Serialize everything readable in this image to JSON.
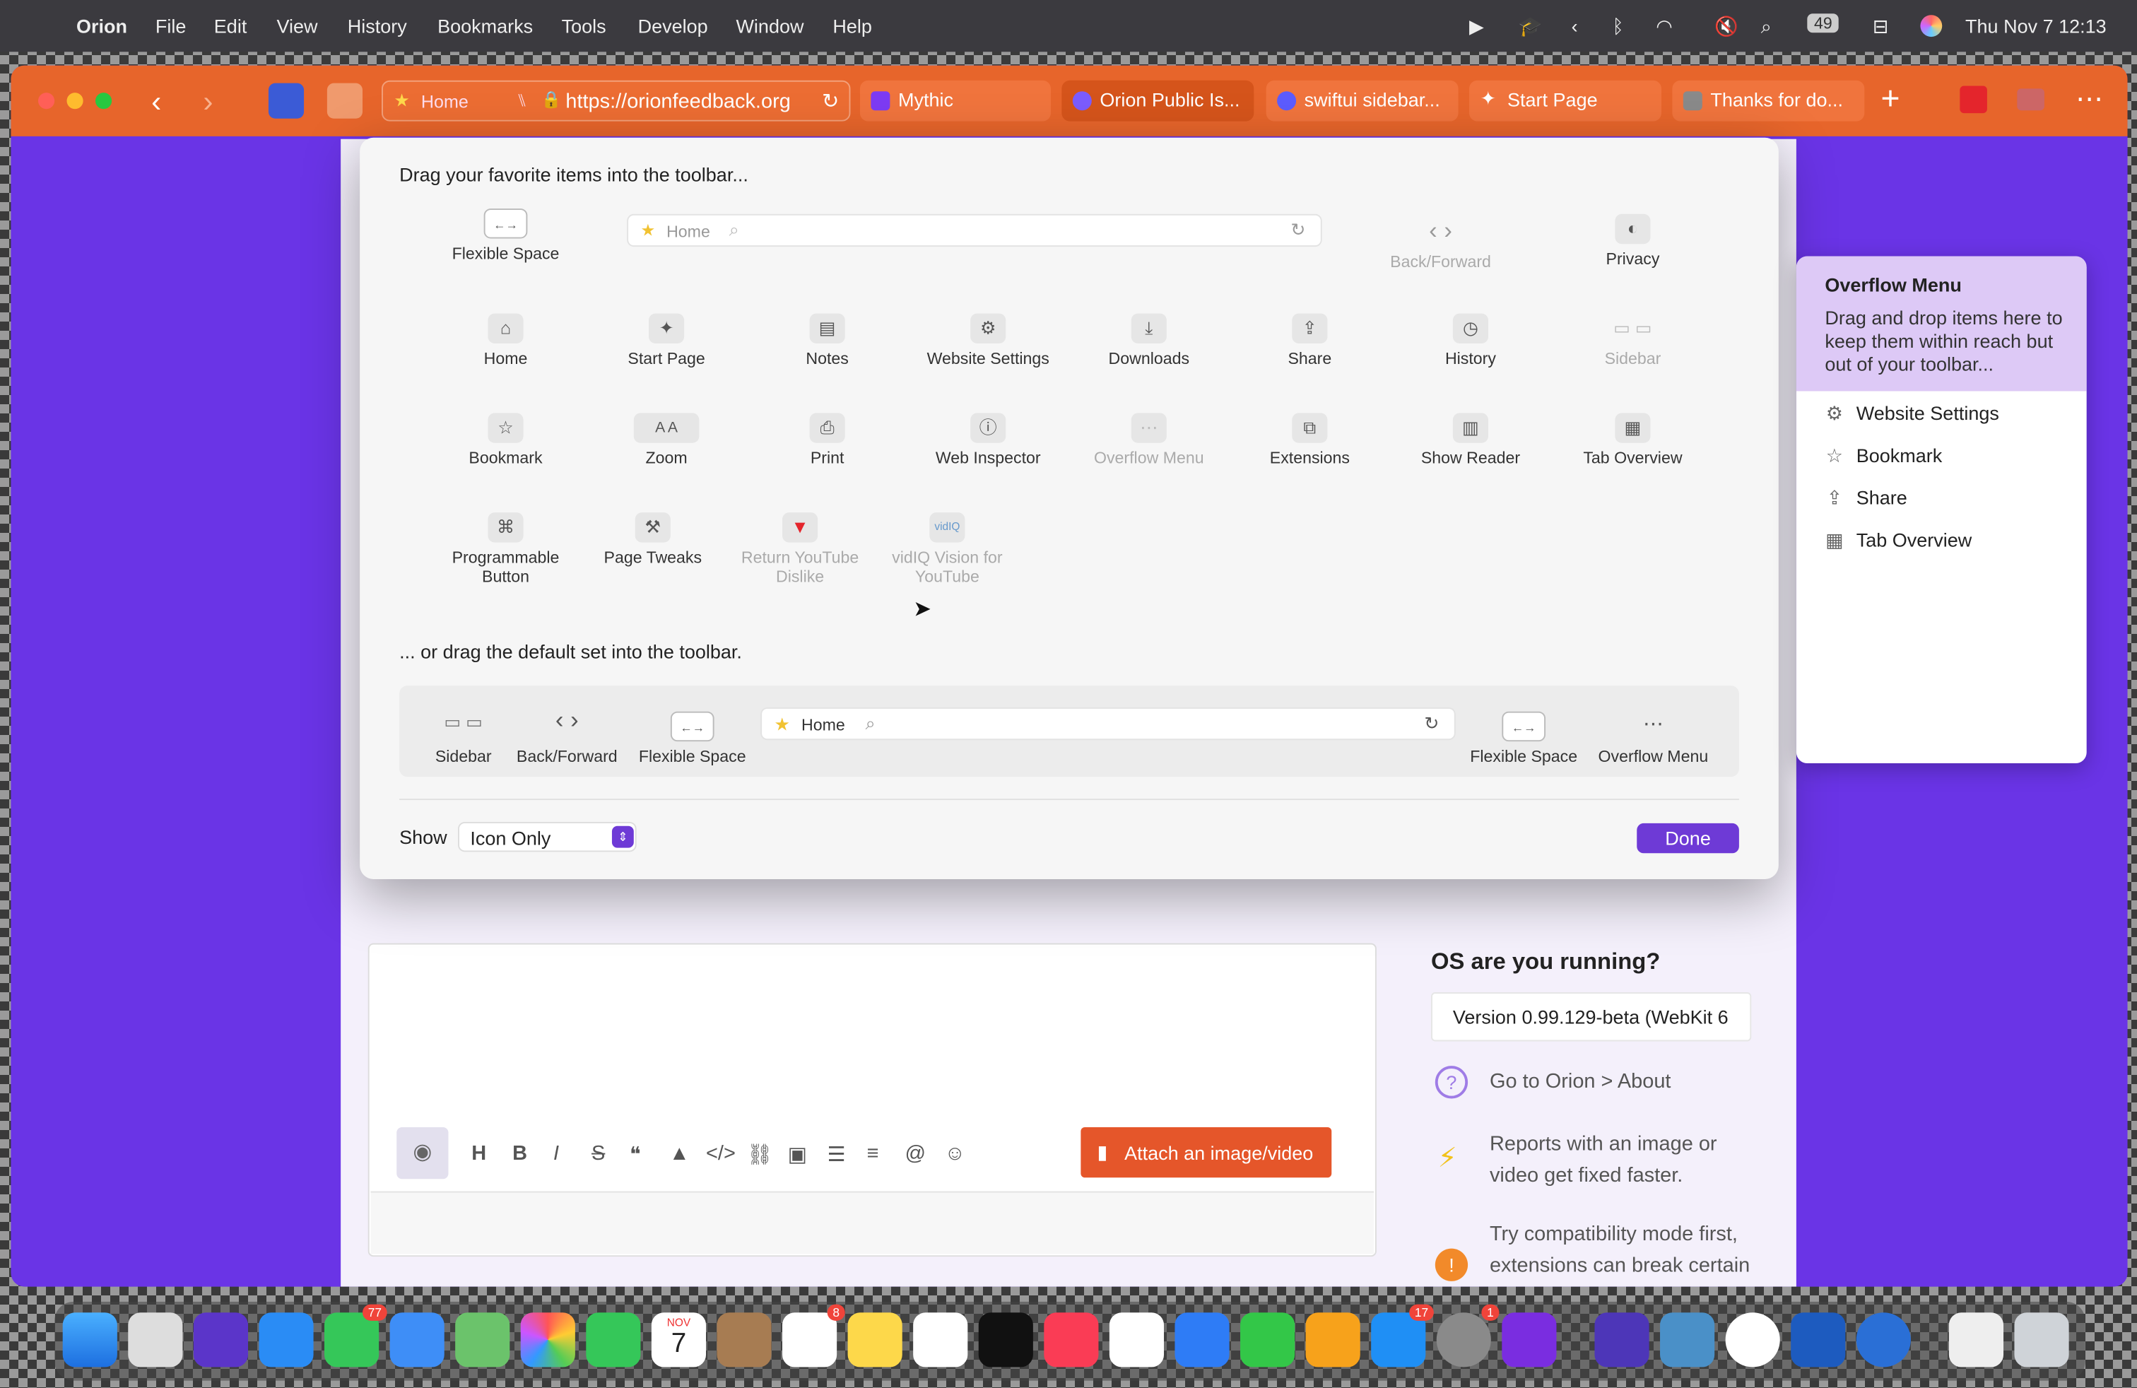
{
  "menubar": {
    "app": "Orion",
    "items": [
      "File",
      "Edit",
      "View",
      "History",
      "Bookmarks",
      "Tools",
      "Develop",
      "Window",
      "Help"
    ],
    "battery": "49",
    "datetime": "Thu Nov 7  12:13"
  },
  "toolbar": {
    "home_label": "Home",
    "url": "https://orionfeedback.org",
    "tabs": [
      {
        "label": "Mythic"
      },
      {
        "label": "Orion Public Is..."
      },
      {
        "label": "swiftui sidebar..."
      },
      {
        "label": "Start Page"
      },
      {
        "label": "Thanks for do..."
      }
    ]
  },
  "sheet": {
    "heading": "Drag your favorite items into the toolbar...",
    "row1": {
      "flexible_space": "Flexible Space",
      "home_chip": "Home",
      "back_forward": "Back/Forward",
      "privacy": "Privacy"
    },
    "row2": [
      "Home",
      "Start Page",
      "Notes",
      "Website Settings",
      "Downloads",
      "Share",
      "History",
      "Sidebar"
    ],
    "row3": [
      "Bookmark",
      "Zoom",
      "Print",
      "Web Inspector",
      "Overflow Menu",
      "Extensions",
      "Show Reader",
      "Tab Overview"
    ],
    "row4": [
      "Programmable Button",
      "Page Tweaks",
      "Return YouTube Dislike",
      "vidIQ Vision for YouTube"
    ],
    "default_heading": "... or drag the default set into the toolbar.",
    "default_set": {
      "sidebar": "Sidebar",
      "back_forward": "Back/Forward",
      "flex1": "Flexible Space",
      "home_chip": "Home",
      "flex2": "Flexible Space",
      "overflow": "Overflow Menu"
    },
    "show_label": "Show",
    "show_value": "Icon Only",
    "done": "Done"
  },
  "overflow_panel": {
    "title": "Overflow Menu",
    "desc": "Drag and drop items here to keep them within reach but out of your toolbar...",
    "items": [
      "Website Settings",
      "Bookmark",
      "Share",
      "Tab Overview"
    ]
  },
  "page": {
    "question": "OS are you running?",
    "version": "Version 0.99.129-beta (WebKit 6",
    "tip1": "Go to Orion > About",
    "tip2": "Reports with an image or video get fixed faster.",
    "tip3": "Try compatibility mode first, extensions can break certain websites.",
    "attach": "Attach an image/video"
  },
  "dock": {
    "badges": {
      "messages": "77",
      "reminders": "8",
      "appstore": "17",
      "settings": "1"
    },
    "calendar_month": "NOV",
    "calendar_day": "7"
  },
  "colors": {
    "toolbar": "#e7652b",
    "accent": "#6a34e6",
    "done": "#6e3ad6"
  }
}
